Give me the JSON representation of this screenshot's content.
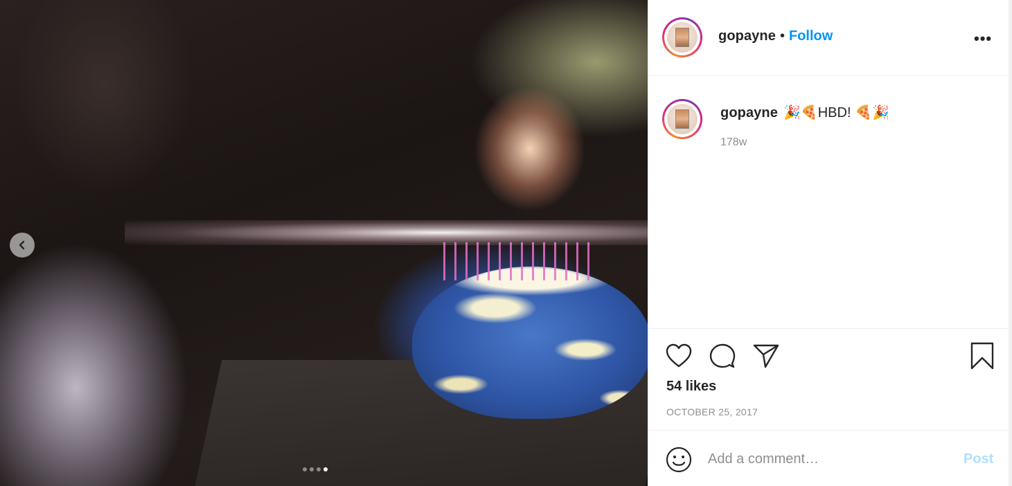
{
  "post": {
    "username": "gopayne",
    "separator": "•",
    "follow_label": "Follow",
    "more_icon": "more-options-icon",
    "more_label": "•••"
  },
  "media": {
    "carousel_dots": 4,
    "active_dot": 3,
    "prev_icon": "chevron-left-icon"
  },
  "caption": {
    "username": "gopayne",
    "text": "🎉🍕HBD! 🍕🎉",
    "age": "178w"
  },
  "actions": {
    "like_icon": "heart-icon",
    "comment_icon": "comment-icon",
    "share_icon": "send-icon",
    "save_icon": "bookmark-icon"
  },
  "likes": "54 likes",
  "date": "OCTOBER 25, 2017",
  "comment": {
    "emoji_icon": "smiley-icon",
    "placeholder": "Add a comment…",
    "post_label": "Post"
  },
  "colors": {
    "accent": "#0095f6",
    "post_disabled": "#b2dffc",
    "text": "#262626",
    "muted": "#8e8e8e"
  }
}
